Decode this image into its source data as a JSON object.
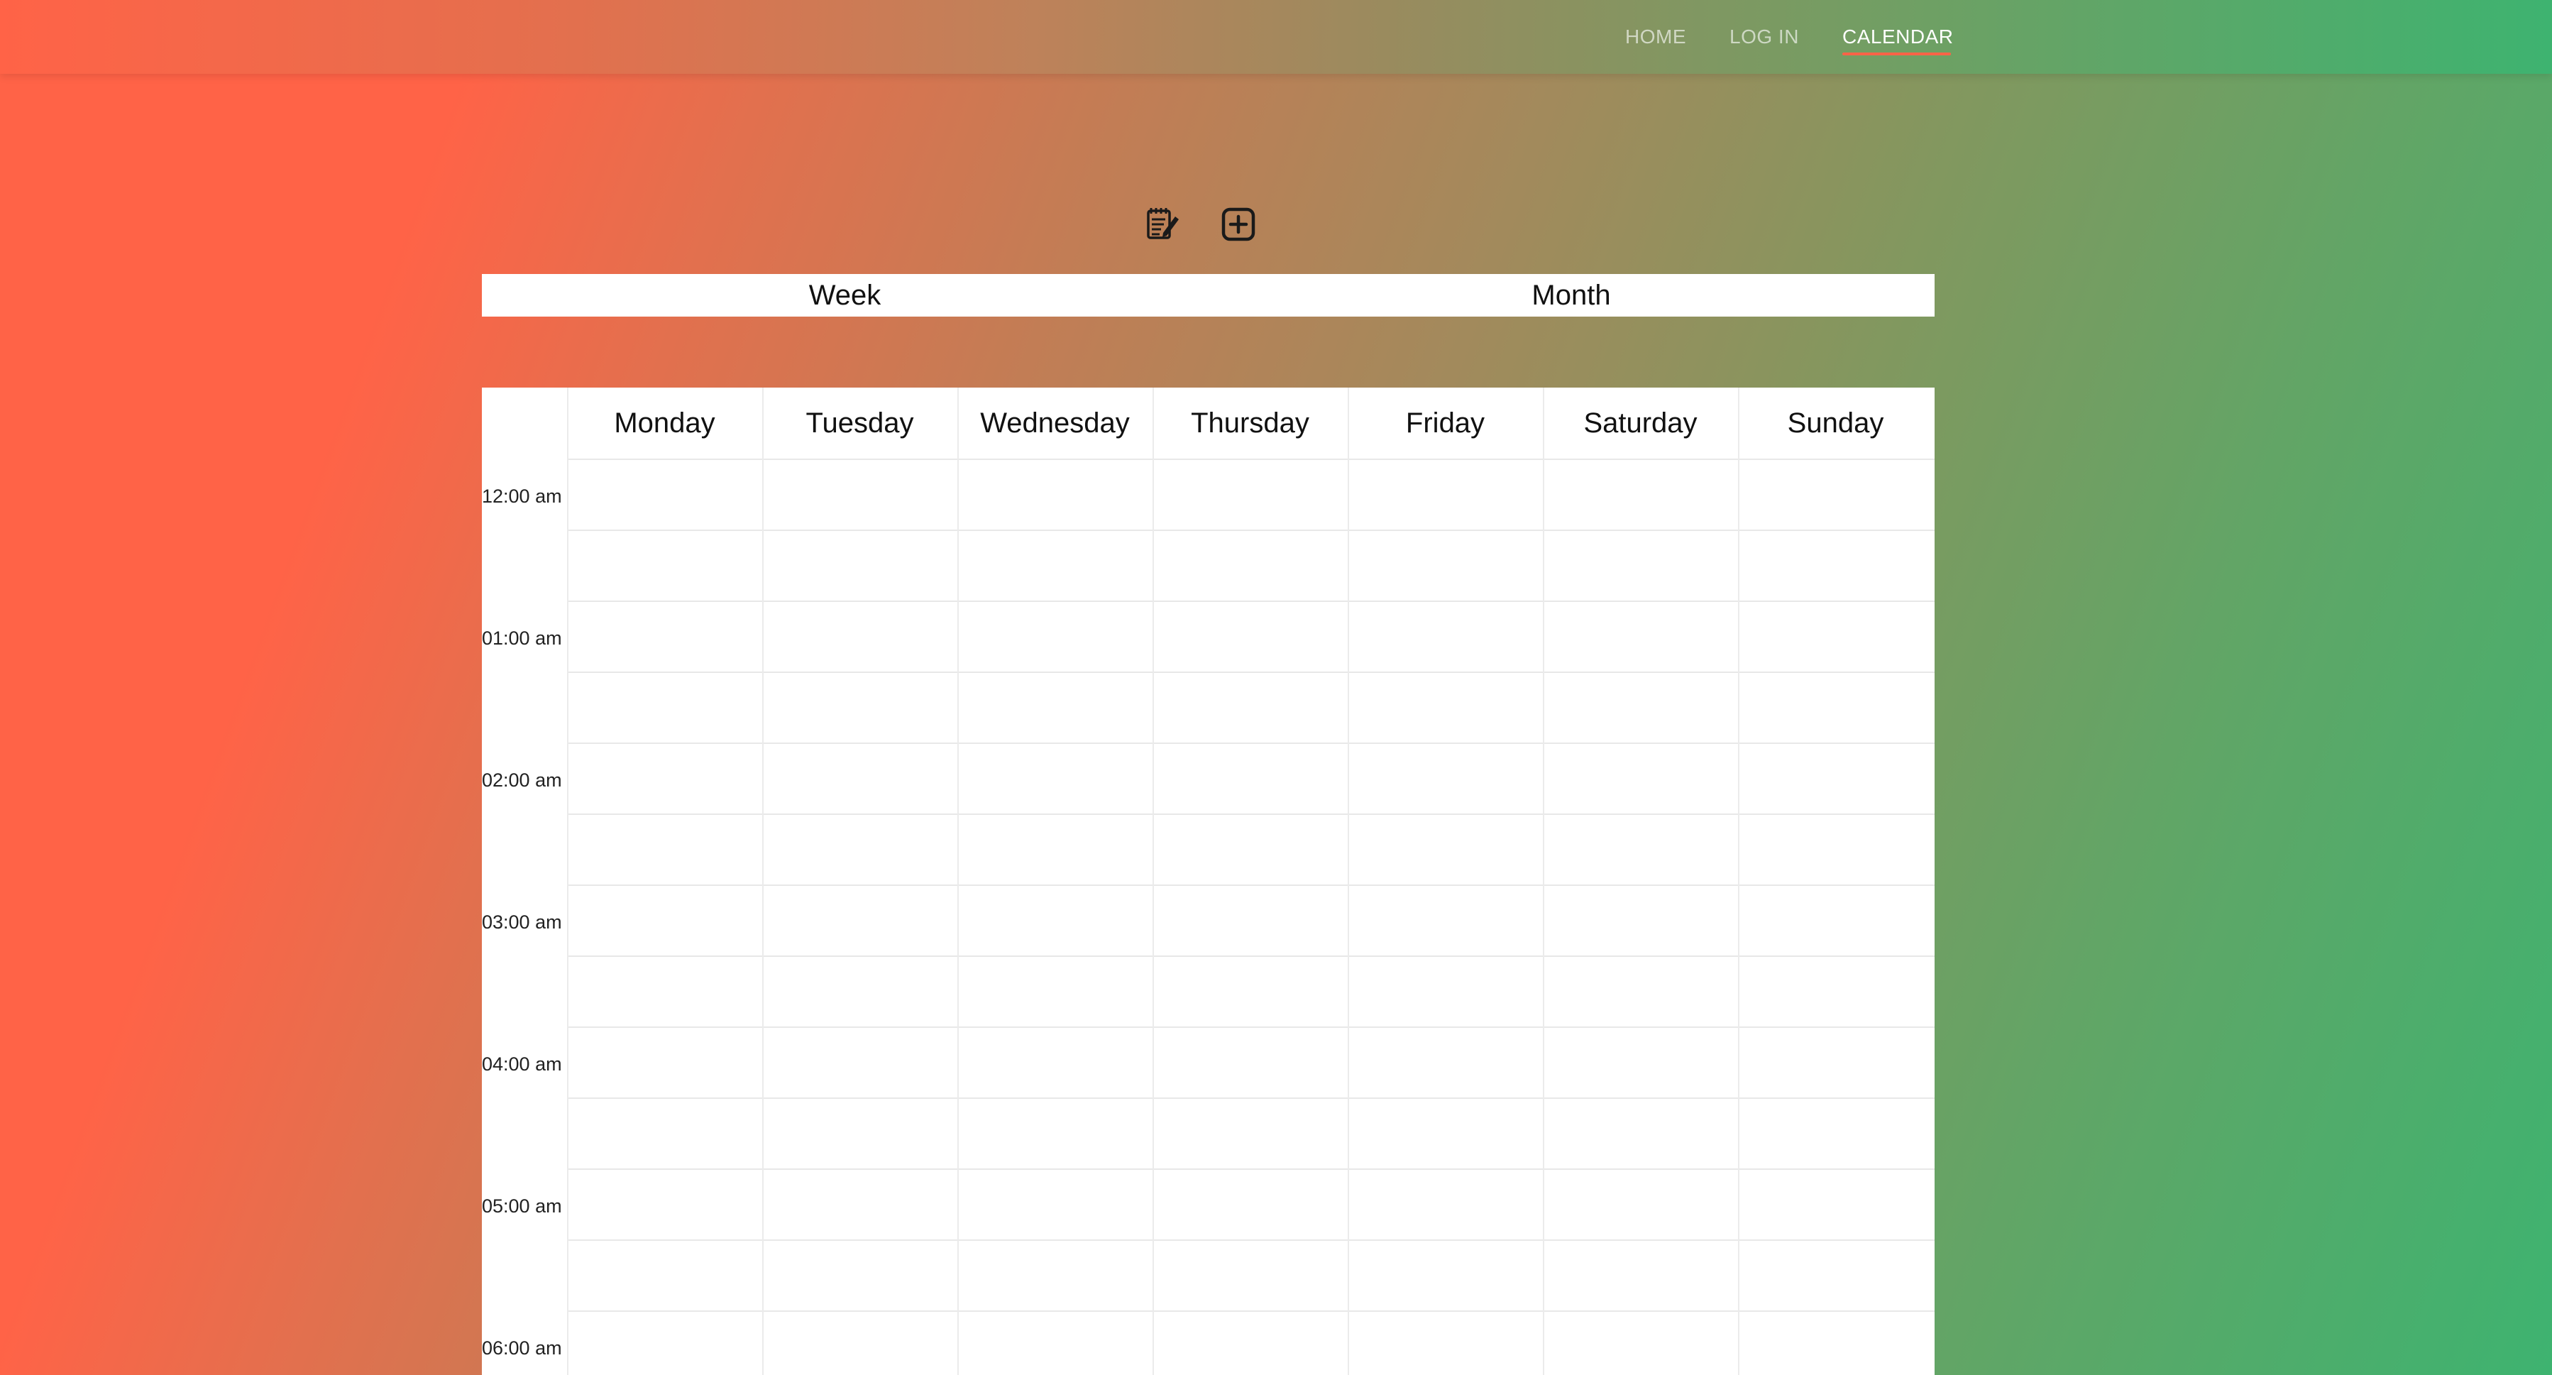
{
  "nav": {
    "links": [
      {
        "label": "HOME",
        "active": false
      },
      {
        "label": "LOG IN",
        "active": false
      },
      {
        "label": "CALENDAR",
        "active": true
      }
    ],
    "accent": "#ff6347"
  },
  "toolbar": {
    "icons": [
      "edit-notes-icon",
      "add-square-icon"
    ]
  },
  "view_toggle": {
    "week_label": "Week",
    "month_label": "Month"
  },
  "calendar": {
    "days": [
      "Monday",
      "Tuesday",
      "Wednesday",
      "Thursday",
      "Friday",
      "Saturday",
      "Sunday"
    ],
    "times": [
      "12:00 am",
      "01:00 am",
      "02:00 am",
      "03:00 am",
      "04:00 am",
      "05:00 am",
      "06:00 am"
    ]
  },
  "colors": {
    "gradient_start": "#ff6347",
    "gradient_end": "#3eb370"
  }
}
